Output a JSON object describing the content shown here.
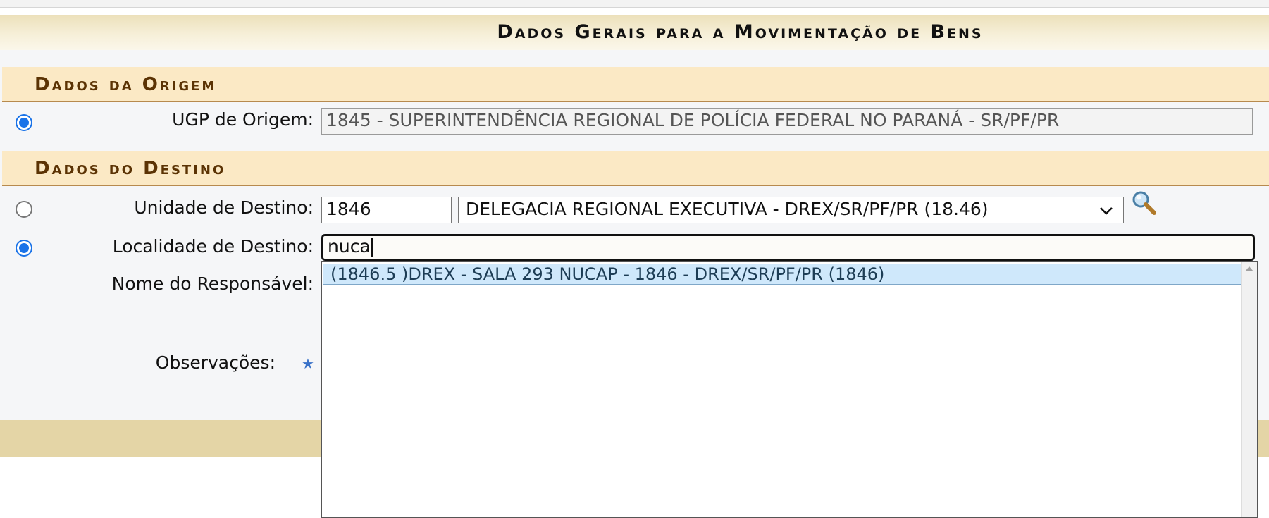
{
  "page_title": "Dados Gerais para a Movimentação de Bens",
  "origem": {
    "section_title": "Dados da Origem",
    "ugp_label": "UGP de Origem:",
    "ugp_value": "1845 - SUPERINTENDÊNCIA REGIONAL DE POLÍCIA FEDERAL NO PARANÁ - SR/PF/PR"
  },
  "destino": {
    "section_title": "Dados do Destino",
    "unidade_label": "Unidade de Destino:",
    "unidade_code": "1846",
    "unidade_selected": "DELEGACIA REGIONAL EXECUTIVA - DREX/SR/PF/PR (18.46)",
    "localidade_label": "Localidade de Destino:",
    "localidade_value": "nuca",
    "responsavel_label": "Nome do Responsável:",
    "observacoes_label": "Observações:"
  },
  "autocomplete": {
    "items": [
      "(1846.5 )DREX - SALA 293 NUCAP - 1846 - DREX/SR/PF/PR (1846)"
    ]
  },
  "icons": {
    "search": "magnifier-icon",
    "required": "star-icon",
    "select_arrow": "chevron-down-icon"
  },
  "colors": {
    "section_text": "#5b3304",
    "section_bg": "#fbe9c5",
    "radio_accent": "#1a73e8",
    "suggestion_bg": "#cfe8fb"
  }
}
